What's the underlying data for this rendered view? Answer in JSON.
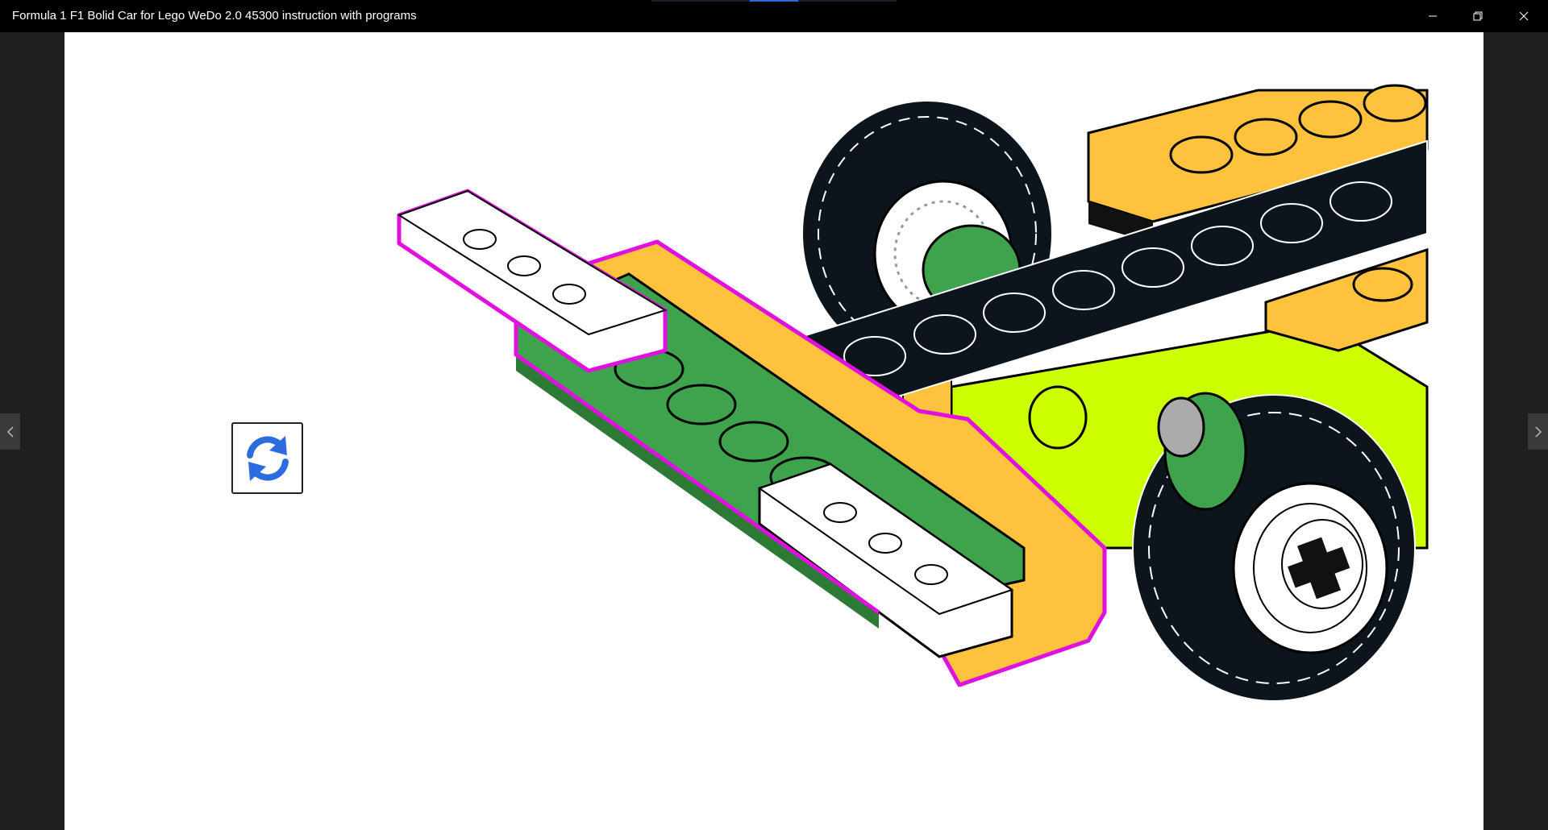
{
  "window": {
    "title": "Formula 1 F1 Bolid Car for Lego WeDo 2.0 45300 instruction with programs",
    "controls": {
      "minimize_icon": "minimize-icon",
      "maximize_icon": "restore-icon",
      "close_icon": "close-icon"
    }
  },
  "viewer": {
    "refresh_icon": "refresh-icon",
    "prev_icon": "chevron-left-icon",
    "next_icon": "chevron-right-icon",
    "accent_color": "#2d6cdf"
  },
  "colors": {
    "highlight": "#e010e0",
    "brick_orange": "#ffc23d",
    "brick_green": "#3fa34d",
    "brick_lime": "#ccff00",
    "tire": "#0c141c",
    "plate_white": "#ffffff"
  }
}
